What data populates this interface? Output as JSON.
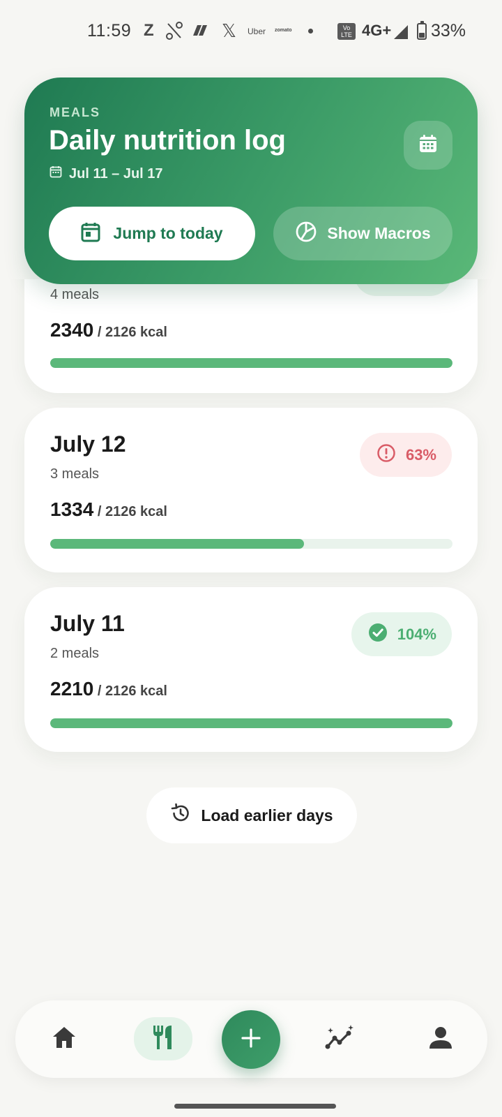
{
  "status_bar": {
    "time": "11:59",
    "app_z": "Z",
    "app_x": "𝕏",
    "app_uber": "Uber",
    "app_zomato": "zomato",
    "volte": "Vo LTE",
    "network": "4G+",
    "battery": "33%",
    "battery_level": 0.33
  },
  "header": {
    "eyebrow": "MEALS",
    "title": "Daily nutrition log",
    "date_range": "Jul 11 – Jul 17",
    "jump_today_label": "Jump to today",
    "show_macros_label": "Show Macros"
  },
  "days": [
    {
      "date": "",
      "meals": "4 meals",
      "kcal_eaten": "2340",
      "kcal_goal": "/ 2126 kcal",
      "progress": 1.0,
      "badge": "",
      "badge_status": "ok"
    },
    {
      "date": "July 12",
      "meals": "3 meals",
      "kcal_eaten": "1334",
      "kcal_goal": "/ 2126 kcal",
      "progress": 0.63,
      "badge": "63%",
      "badge_status": "low"
    },
    {
      "date": "July 11",
      "meals": "2 meals",
      "kcal_eaten": "2210",
      "kcal_goal": "/ 2126 kcal",
      "progress": 1.0,
      "badge": "104%",
      "badge_status": "ok"
    }
  ],
  "load_earlier_label": "Load earlier days",
  "nav": {
    "items": [
      "home-icon",
      "meals-icon",
      "add-icon",
      "insights-icon",
      "profile-icon"
    ],
    "active": "meals"
  },
  "colors": {
    "accent": "#1f7a52",
    "progress": "#5bb87a",
    "warning": "#d95c67",
    "success": "#4cae72"
  }
}
